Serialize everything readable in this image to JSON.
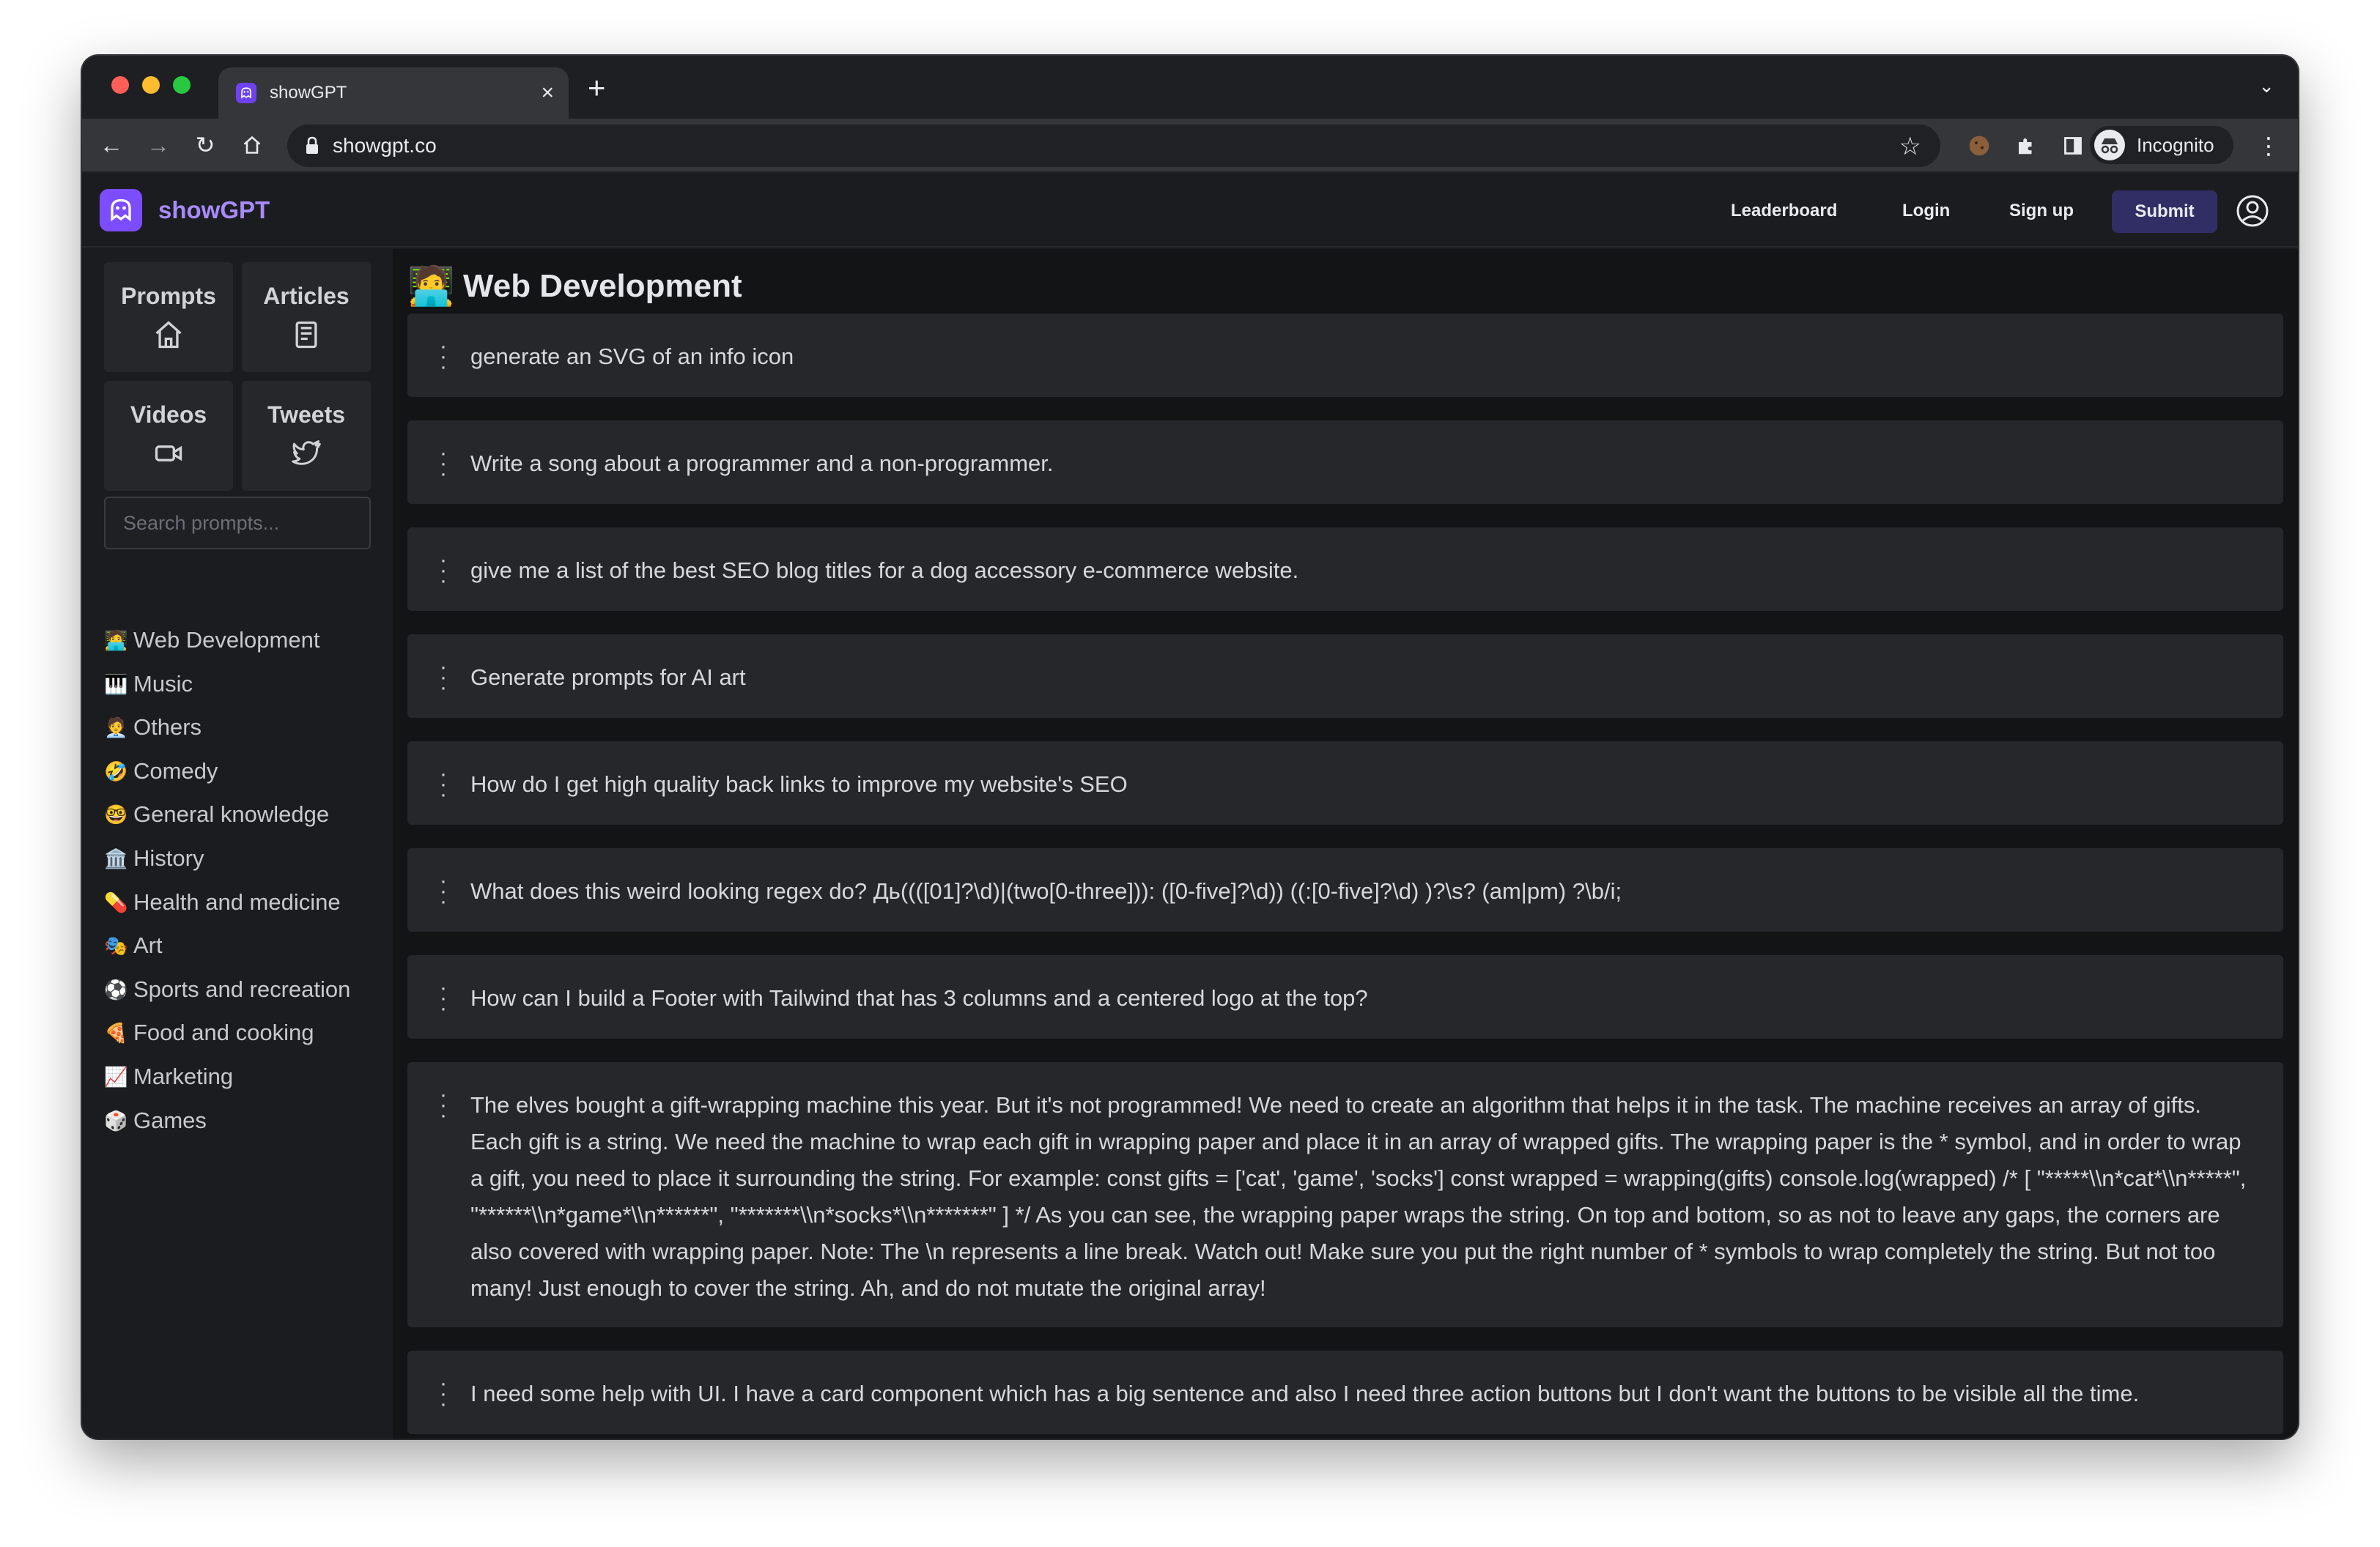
{
  "browser": {
    "tab_title": "showGPT",
    "url": "showgpt.co",
    "incognito_label": "Incognito",
    "colors": {
      "close": "#ff5f57",
      "minimize": "#febc2e",
      "zoom": "#28c840"
    }
  },
  "site": {
    "brand": "showGPT",
    "nav": {
      "leaderboard": "Leaderboard",
      "login": "Login",
      "signup": "Sign up",
      "submit": "Submit"
    },
    "accent": "#7c4dff"
  },
  "sidebar": {
    "tiles": [
      {
        "label": "Prompts",
        "icon": "home-icon"
      },
      {
        "label": "Articles",
        "icon": "article-icon"
      },
      {
        "label": "Videos",
        "icon": "video-icon"
      },
      {
        "label": "Tweets",
        "icon": "twitter-icon"
      }
    ],
    "search_placeholder": "Search prompts...",
    "categories": [
      {
        "emoji": "🧑‍💻",
        "label": "Web Development"
      },
      {
        "emoji": "🎹",
        "label": "Music"
      },
      {
        "emoji": "🧑‍💼",
        "label": "Others"
      },
      {
        "emoji": "🤣",
        "label": "Comedy"
      },
      {
        "emoji": "🤓",
        "label": "General knowledge"
      },
      {
        "emoji": "🏛️",
        "label": "History"
      },
      {
        "emoji": "💊",
        "label": "Health and medicine"
      },
      {
        "emoji": "🎭",
        "label": "Art"
      },
      {
        "emoji": "⚽",
        "label": "Sports and recreation"
      },
      {
        "emoji": "🍕",
        "label": "Food and cooking"
      },
      {
        "emoji": "📈",
        "label": "Marketing"
      },
      {
        "emoji": "🎲",
        "label": "Games"
      }
    ]
  },
  "main": {
    "heading_emoji": "🧑‍💻",
    "heading": "Web Development",
    "prompts": [
      "generate an SVG of an info icon",
      "Write a song about a programmer and a non-programmer.",
      "give me a list of the best SEO blog titles for a dog accessory e-commerce website.",
      "Generate prompts for AI art",
      "How do I get high quality back links to improve my website's SEO",
      "What does this weird looking regex do? Дь((([01]?\\d)|(two[0-three])): ([0-five]?\\d)) ((:[0-five]?\\d) )?\\s? (am|pm) ?\\b/i;",
      "How can I build a Footer with Tailwind that has 3 columns and a centered logo at the top?",
      "The elves bought a gift-wrapping machine this year. But it's not programmed! We need to create an algorithm that helps it in the task. The machine receives an array of gifts. Each gift is a string. We need the machine to wrap each gift in wrapping paper and place it in an array of wrapped gifts. The wrapping paper is the * symbol, and in order to wrap a gift, you need to place it surrounding the string. For example: const gifts = ['cat', 'game', 'socks'] const wrapped = wrapping(gifts) console.log(wrapped) /* [ \"*****\\\\n*cat*\\\\n*****\", \"******\\\\n*game*\\\\n******\", \"*******\\\\n*socks*\\\\n*******\" ] */ As you can see, the wrapping paper wraps the string. On top and bottom, so as not to leave any gaps, the corners are also covered with wrapping paper. Note: The \\n represents a line break. Watch out! Make sure you put the right number of * symbols to wrap completely the string. But not too many! Just enough to cover the string. Ah, and do not mutate the original array!",
      "I need some help with UI. I have a card component which has a big sentence and also I need three action buttons but I don't want the buttons to be visible all the time."
    ]
  }
}
